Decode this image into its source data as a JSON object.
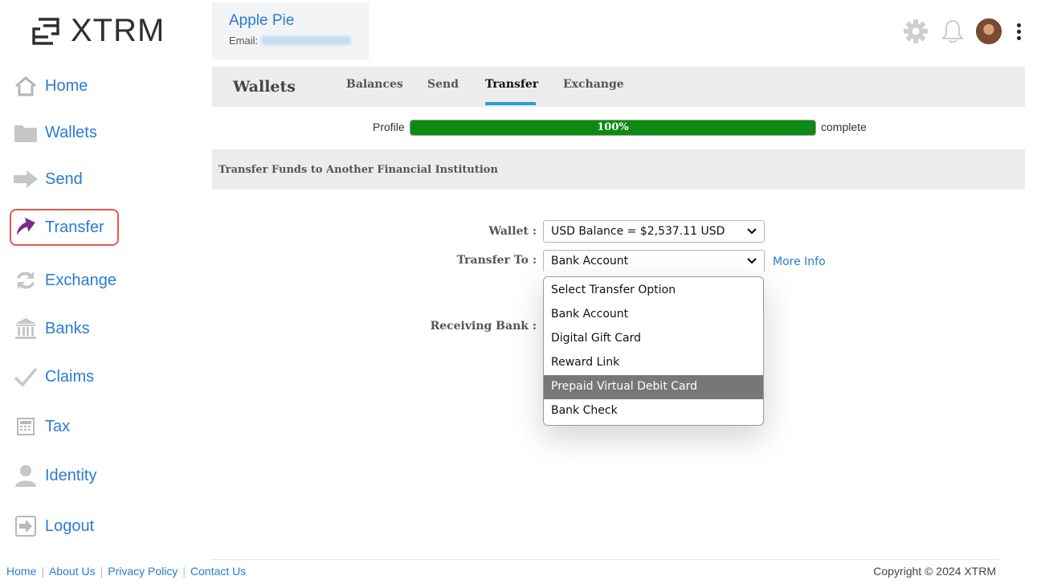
{
  "brand": {
    "name": "XTRM"
  },
  "user": {
    "name": "Apple Pie",
    "email_label": "Email:"
  },
  "header_icons": [
    "gear-icon",
    "bell-icon",
    "avatar",
    "more-vertical-icon"
  ],
  "sidebar": {
    "items": [
      {
        "label": "Home",
        "icon": "home-icon"
      },
      {
        "label": "Wallets",
        "icon": "folder-icon"
      },
      {
        "label": "Send",
        "icon": "arrow-right-icon"
      },
      {
        "label": "Transfer",
        "icon": "transfer-arrow-icon",
        "active": true
      },
      {
        "label": "Exchange",
        "icon": "exchange-icon"
      },
      {
        "label": "Banks",
        "icon": "bank-icon"
      },
      {
        "label": "Claims",
        "icon": "checkmark-icon"
      },
      {
        "label": "Tax",
        "icon": "calculator-icon"
      },
      {
        "label": "Identity",
        "icon": "person-icon"
      },
      {
        "label": "Logout",
        "icon": "logout-icon"
      }
    ]
  },
  "tabs": {
    "title": "Wallets",
    "items": [
      {
        "label": "Balances"
      },
      {
        "label": "Send"
      },
      {
        "label": "Transfer",
        "active": true
      },
      {
        "label": "Exchange"
      }
    ]
  },
  "profile": {
    "prefix": "Profile",
    "percent_text": "100%",
    "percent": 100,
    "suffix": "complete"
  },
  "section": {
    "title": "Transfer Funds to Another Financial Institution"
  },
  "form": {
    "wallet_label": "Wallet :",
    "wallet_value": "USD Balance = $2,537.11 USD",
    "transfer_to_label": "Transfer To :",
    "transfer_to_value": "Bank Account",
    "more_info": "More Info",
    "receiving_bank_label": "Receiving Bank :"
  },
  "dropdown": {
    "options": [
      "Select Transfer Option",
      "Bank Account",
      "Digital Gift Card",
      "Reward Link",
      "Prepaid Virtual Debit Card",
      "Bank Check"
    ],
    "highlighted": "Prepaid Virtual Debit Card"
  },
  "footer": {
    "links": [
      "Home",
      "About Us",
      "Privacy Policy",
      "Contact Us"
    ],
    "copyright": "Copyright © 2024 XTRM"
  },
  "colors": {
    "link": "#2a7bd6",
    "progress": "#0d8a12",
    "tab_underline": "#2a9fd6",
    "active_outline": "#e05a4a",
    "transfer_icon": "#7b2d8e"
  }
}
